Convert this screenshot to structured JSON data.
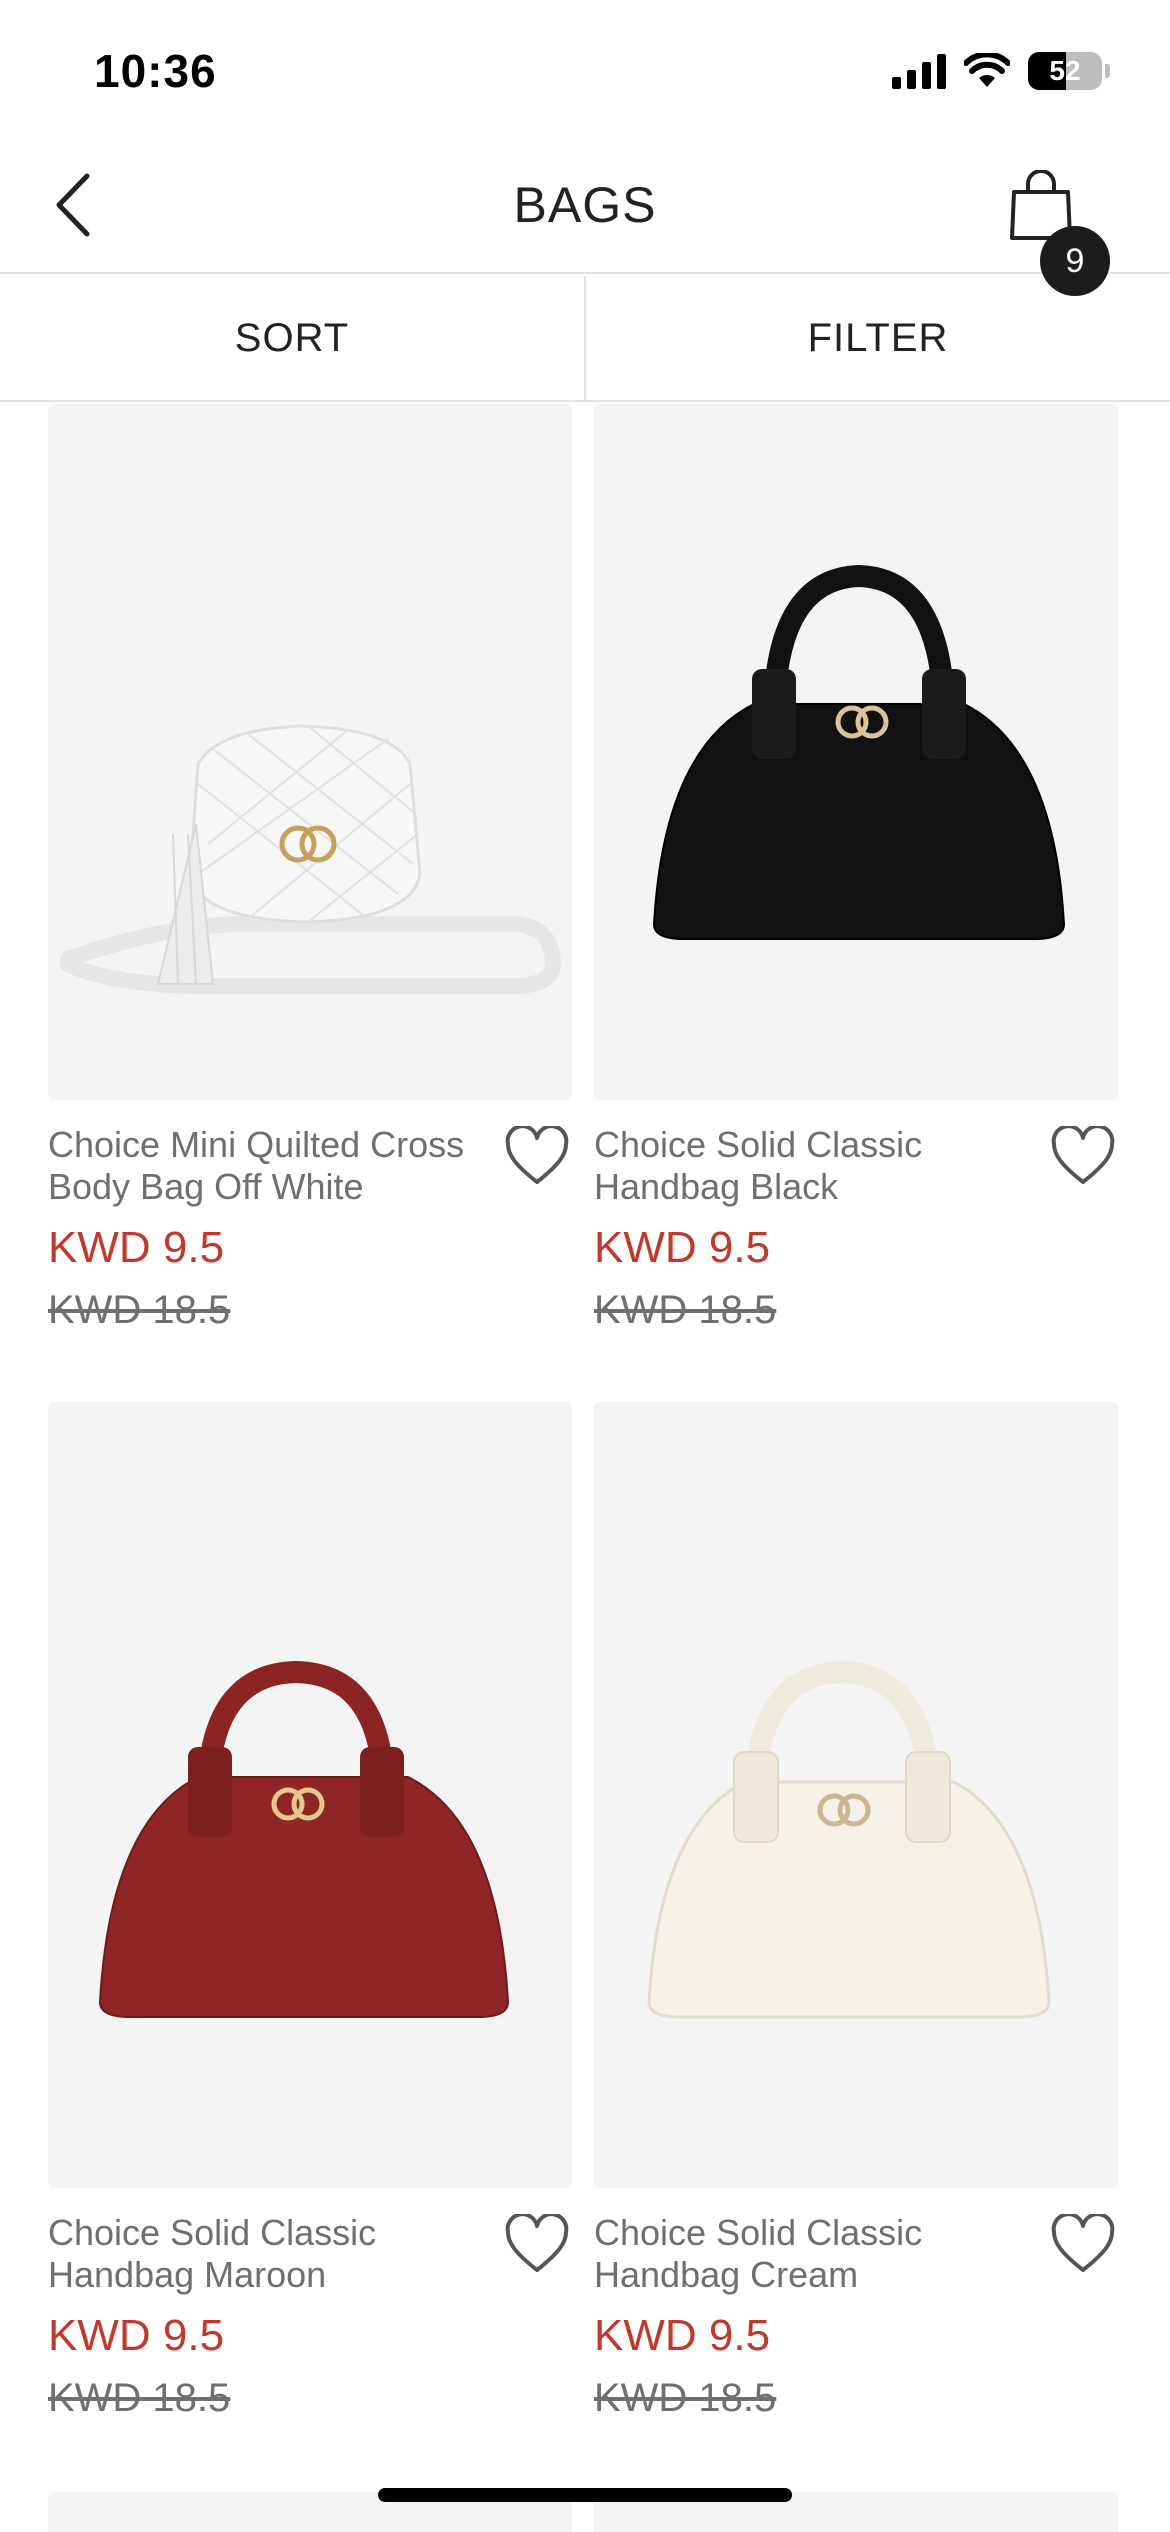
{
  "status_bar": {
    "time": "10:36",
    "battery": "52",
    "battery_level": 0.52
  },
  "header": {
    "title": "BAGS",
    "cart_count": "9"
  },
  "toolbar": {
    "sort_label": "SORT",
    "filter_label": "FILTER"
  },
  "products": [
    {
      "name": "Choice Mini Quilted Cross Body Bag Off White",
      "price": "KWD 9.5",
      "old_price": "KWD 18.5",
      "color": "#f5f5f3",
      "icon": "crossbody-bag-image"
    },
    {
      "name": "Choice Solid Classic Handbag Black",
      "price": "KWD 9.5",
      "old_price": "KWD 18.5",
      "color": "#111111",
      "icon": "handbag-image"
    },
    {
      "name": "Choice Solid Classic Handbag Maroon",
      "price": "KWD 9.5",
      "old_price": "KWD 18.5",
      "color": "#8f2526",
      "icon": "handbag-image"
    },
    {
      "name": "Choice Solid Classic Handbag Cream",
      "price": "KWD 9.5",
      "old_price": "KWD 18.5",
      "color": "#f4f0e8",
      "icon": "handbag-image"
    }
  ],
  "colors": {
    "price": "#c0392b",
    "image_bg": "#f4f4f4",
    "text_muted": "#6f6f6f"
  }
}
